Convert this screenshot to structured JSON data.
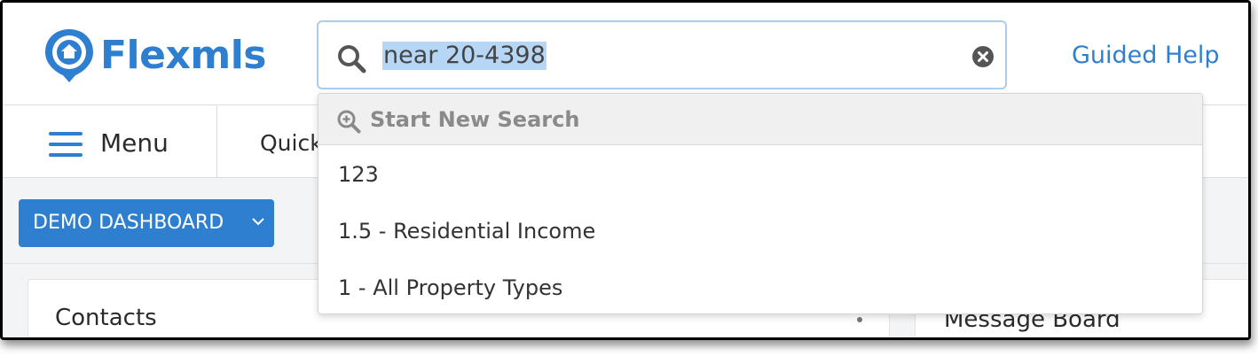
{
  "app": {
    "logo_text": "Flexmls"
  },
  "search": {
    "value": "near 20-4398"
  },
  "header": {
    "guided_help": "Guided Help"
  },
  "nav": {
    "menu_label": "Menu",
    "quick_label": "Quick"
  },
  "dashboard": {
    "demo_button": "DEMO DASHBOARD"
  },
  "cards": {
    "contacts_title": "Contacts",
    "message_board_title": "Message Board"
  },
  "dropdown": {
    "header_label": "Start New Search",
    "items": [
      "123",
      "1.5 - Residential Income",
      "1 - All Property Types"
    ]
  },
  "colors": {
    "brand": "#2f7fd0",
    "selection": "#b6d6f6",
    "focus_border": "#a9cdf0"
  }
}
